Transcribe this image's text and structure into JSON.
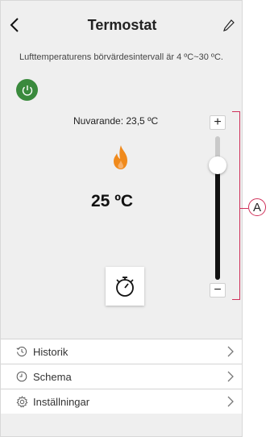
{
  "header": {
    "title": "Termostat",
    "back_icon": "chevron-left-icon",
    "edit_icon": "pencil-icon"
  },
  "info_text": "Lufttemperaturens börvärdesintervall är 4 ºC~30 ºC.",
  "power": {
    "icon": "power-icon",
    "color": "#3a8a3d"
  },
  "current_temperature": "Nuvarande: 23,5 ºC",
  "flame": {
    "icon": "flame-icon",
    "color": "#f08a1c"
  },
  "setpoint": "25 ºC",
  "timer": {
    "icon": "stopwatch-icon"
  },
  "slider": {
    "plus_label": "+",
    "minus_label": "−",
    "level": 0.8
  },
  "menu": [
    {
      "icon": "history-icon",
      "label": "Historik"
    },
    {
      "icon": "clock-icon",
      "label": "Schema"
    },
    {
      "icon": "gear-icon",
      "label": "Inställningar"
    }
  ],
  "callout": {
    "label": "A",
    "color": "#d0315a"
  }
}
